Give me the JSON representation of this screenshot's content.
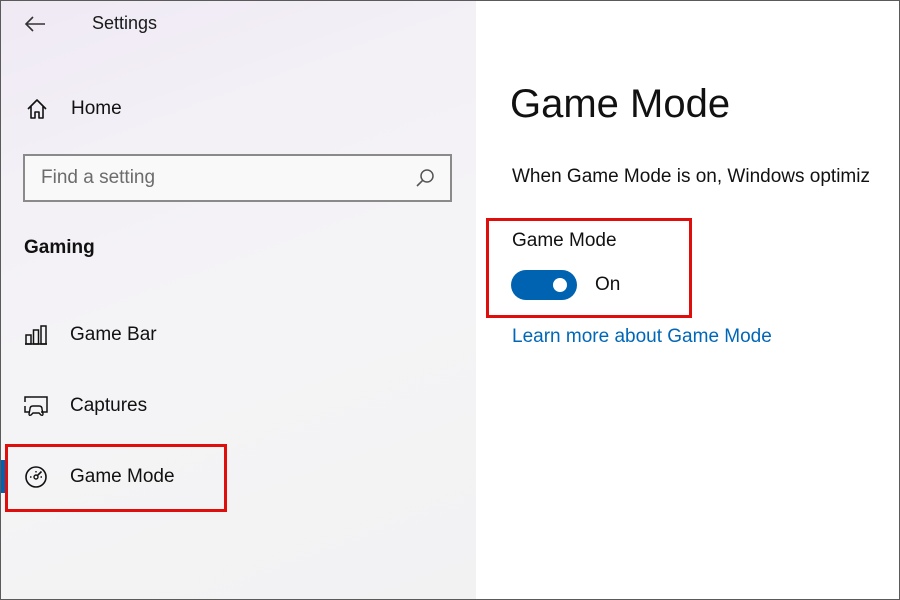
{
  "window": {
    "title": "Settings"
  },
  "sidebar": {
    "home_label": "Home",
    "search": {
      "placeholder": "Find a setting",
      "value": ""
    },
    "section_heading": "Gaming",
    "items": [
      {
        "label": "Game Bar",
        "icon": "game-bar-icon"
      },
      {
        "label": "Captures",
        "icon": "captures-icon"
      },
      {
        "label": "Game Mode",
        "icon": "game-mode-icon",
        "selected": true
      }
    ]
  },
  "main": {
    "title": "Game Mode",
    "description": "When Game Mode is on, Windows optimiz",
    "setting_label": "Game Mode",
    "toggle": {
      "on": true,
      "state_label": "On"
    },
    "learn_more": "Learn more about Game Mode"
  },
  "colors": {
    "accent": "#0063b1",
    "link": "#0067b8",
    "highlight": "#e00d0d"
  }
}
